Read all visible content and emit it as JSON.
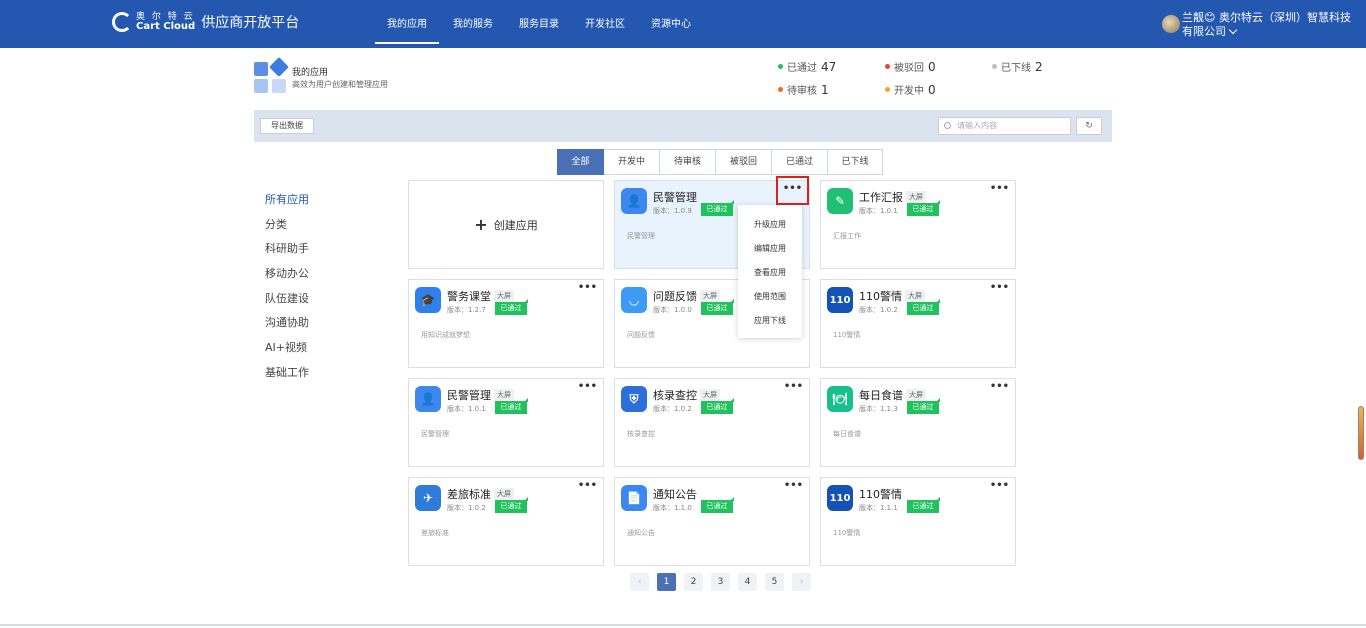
{
  "topbar": {
    "logo_cn": "奥 尔 特 云",
    "logo_en": "Cart Cloud",
    "platform_name": "供应商开放平台",
    "nav": [
      {
        "label": "我的应用",
        "active": true
      },
      {
        "label": "我的服务",
        "active": false
      },
      {
        "label": "服务目录",
        "active": false
      },
      {
        "label": "开发社区",
        "active": false
      },
      {
        "label": "资源中心",
        "active": false
      }
    ],
    "user_name": "兰靓😊 奥尔特云（深圳）智慧科技",
    "user_org": "有限公司"
  },
  "header": {
    "title": "我的应用",
    "subtitle": "高效为用户创建和管理应用"
  },
  "stats": [
    {
      "label": "已通过",
      "value": "47",
      "color": "#21c25e"
    },
    {
      "label": "被驳回",
      "value": "0",
      "color": "#f04134"
    },
    {
      "label": "已下线",
      "value": "2",
      "color": "#bfbfbf"
    },
    {
      "label": "待审核",
      "value": "1",
      "color": "#f06a1c"
    },
    {
      "label": "开发中",
      "value": "0",
      "color": "#f5a623"
    }
  ],
  "toolbar": {
    "export_label": "导出数据",
    "search_placeholder": "请输入内容",
    "refresh_icon": "↻"
  },
  "status_tabs": [
    {
      "label": "全部",
      "active": true
    },
    {
      "label": "开发中",
      "active": false
    },
    {
      "label": "待审核",
      "active": false
    },
    {
      "label": "被驳回",
      "active": false
    },
    {
      "label": "已通过",
      "active": false
    },
    {
      "label": "已下线",
      "active": false
    }
  ],
  "sidebar": {
    "items": [
      "所有应用",
      "分类",
      "科研助手",
      "移动办公",
      "队伍建设",
      "沟通协助",
      "AI+视频",
      "基础工作"
    ]
  },
  "create_card": {
    "plus": "+",
    "label": "创建应用"
  },
  "ver_prefix": "版本：",
  "badge_label": "已通过",
  "screen_tag": "大屏",
  "more_glyph": "•••",
  "apps": [
    {
      "name": "民警管理",
      "version": "1.0.9",
      "desc": "民警管理",
      "screen": false,
      "icon": "person-icon",
      "icon_color": "#3d87f0",
      "glyph": "👤"
    },
    {
      "name": "工作汇报",
      "version": "1.0.1",
      "desc": "汇报工作",
      "screen": true,
      "icon": "report-icon",
      "icon_color": "#1fbf74",
      "glyph": "✎"
    },
    {
      "name": "警务课堂",
      "version": "1.2.7",
      "desc": "用知识成就梦想",
      "screen": true,
      "icon": "graduation-icon",
      "icon_color": "#2f80ed",
      "glyph": "🎓"
    },
    {
      "name": "问题反馈",
      "version": "1.0.0",
      "desc": "问题反馈",
      "screen": true,
      "icon": "feedback-icon",
      "icon_color": "#3d9bf5",
      "glyph": "◡"
    },
    {
      "name": "110警情",
      "version": "1.0.2",
      "desc": "110警情",
      "screen": true,
      "icon": "alarm-110-icon",
      "icon_color": "#1452b8",
      "glyph": "110"
    },
    {
      "name": "民警管理",
      "version": "1.0.1",
      "desc": "民警管理",
      "screen": true,
      "icon": "person-icon",
      "icon_color": "#3d87f0",
      "glyph": "👤"
    },
    {
      "name": "核录查控",
      "version": "1.0.2",
      "desc": "核录查控",
      "screen": true,
      "icon": "shield-icon",
      "icon_color": "#2d6fd8",
      "glyph": "⛨"
    },
    {
      "name": "每日食谱",
      "version": "1.1.3",
      "desc": "每日食谱",
      "screen": true,
      "icon": "dish-icon",
      "icon_color": "#17c08a",
      "glyph": "🍽"
    },
    {
      "name": "差旅标准",
      "version": "1.0.2",
      "desc": "差旅标准",
      "screen": true,
      "icon": "airplane-icon",
      "icon_color": "#2e7bd8",
      "glyph": "✈"
    },
    {
      "name": "通知公告",
      "version": "1.1.0",
      "desc": "通知公告",
      "screen": false,
      "icon": "document-icon",
      "icon_color": "#3d87f0",
      "glyph": "📄"
    },
    {
      "name": "110警情",
      "version": "1.1.1",
      "desc": "110警情",
      "screen": false,
      "icon": "alarm-110-icon",
      "icon_color": "#1452b8",
      "glyph": "110"
    }
  ],
  "dropdown": [
    "升级应用",
    "编辑应用",
    "查看应用",
    "使用范围",
    "应用下线"
  ],
  "pager": {
    "prev": "‹",
    "next": "›",
    "pages": [
      "1",
      "2",
      "3",
      "4",
      "5"
    ],
    "current": "1"
  }
}
